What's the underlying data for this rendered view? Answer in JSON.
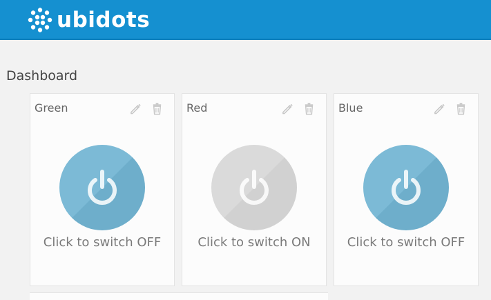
{
  "app": {
    "brand": "ubidots"
  },
  "page": {
    "title": "Dashboard"
  },
  "widgets": [
    {
      "title": "Green",
      "label": "Click to switch OFF",
      "state": "on"
    },
    {
      "title": "Red",
      "label": "Click to switch ON",
      "state": "off"
    },
    {
      "title": "Blue",
      "label": "Click to switch OFF",
      "state": "on"
    }
  ],
  "icons": {
    "edit": "pencil-icon",
    "delete": "trash-icon",
    "power": "power-icon",
    "logo": "ubidots-logo-icon"
  },
  "colors": {
    "header": "#1590d0",
    "switch_on": "#7cbad6",
    "switch_off": "#dadada",
    "background": "#f2f2f2"
  }
}
